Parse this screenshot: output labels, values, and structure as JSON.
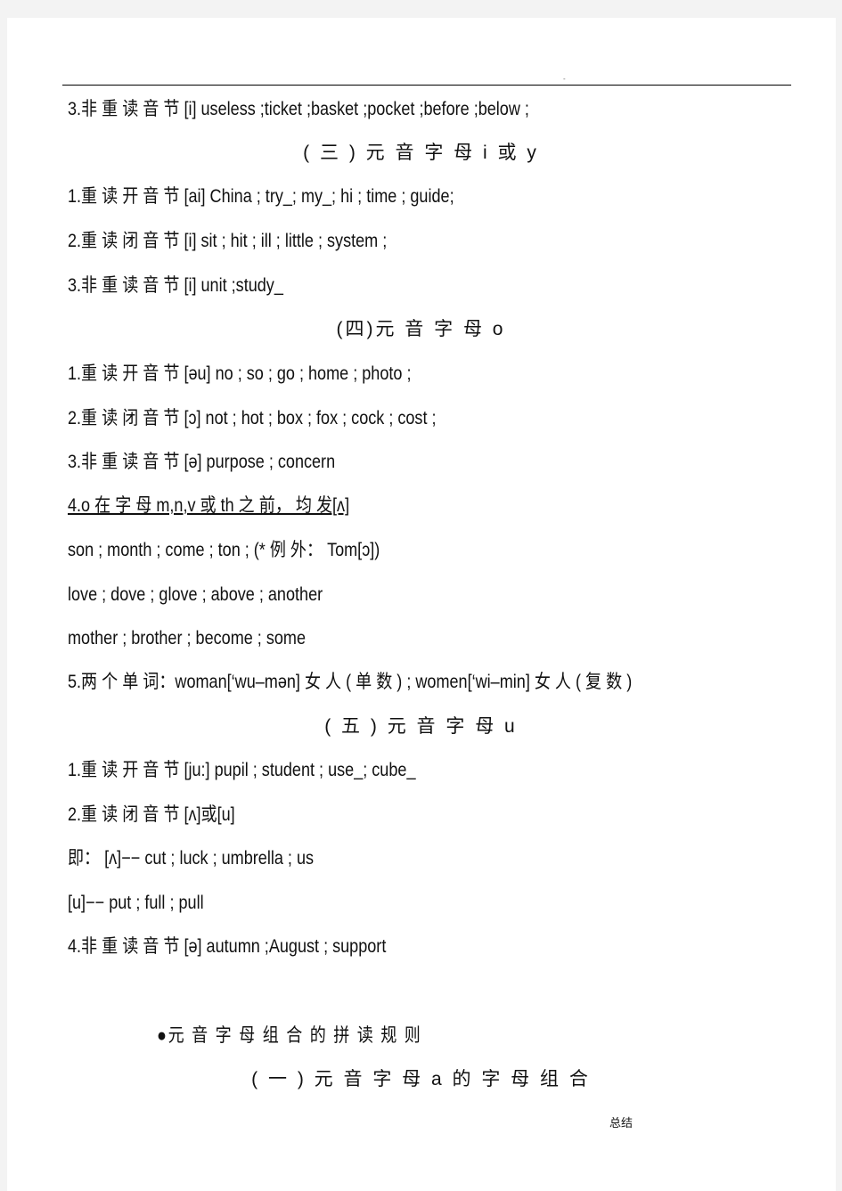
{
  "header": {
    "dot": "-"
  },
  "lines": [
    {
      "text": "3.非 重 读 音 节  [i]  useless  ;ticket  ;basket  ;pocket  ;before  ;below  ;",
      "center": false
    },
    {
      "text": "( 三 ) 元 音 字 母 i 或 y",
      "center": true
    },
    {
      "text": "1.重 读 开 音 节  [ai]  China ; try_; my_; hi ; time ; guide;",
      "center": false
    },
    {
      "text": "2.重 读 闭 音 节  [i]  sit ; hit ; ill ; little ; system ;",
      "center": false
    },
    {
      "text": "3.非 重 读 音 节  [i]  unit  ;study_",
      "center": false
    },
    {
      "text": "(四)元 音 字 母 o",
      "center": true
    },
    {
      "text": "1.重 读 开 音 节  [əu]  no ; so ; go ; home ; photo ;",
      "center": false
    },
    {
      "text": "2.重 读 闭 音 节  [ɔ]  not ; hot ; box ; fox ; cock ; cost ;",
      "center": false
    },
    {
      "text": "3.非 重 读 音 节  [ə]  purpose ; concern",
      "center": false
    },
    {
      "text": "4.o 在 字 母 m,n,v 或 th 之 前， 均 发[ʌ]",
      "center": false,
      "underline": true
    },
    {
      "text": "son ; month ; come ; ton ; (* 例 外： Tom[ɔ])",
      "center": false
    },
    {
      "text": "love ; dove ; glove ; above ; another",
      "center": false
    },
    {
      "text": "mother ; brother ; become ; some",
      "center": false
    },
    {
      "text": "5.两 个 单 词：woman[‘wu–mən] 女 人 ( 单 数 )  ; women[‘wi–min] 女 人 ( 复 数 )",
      "center": false
    },
    {
      "text": "( 五 ) 元 音 字 母 u",
      "center": true
    },
    {
      "text": "1.重 读 开 音 节  [ju:]  pupil ; student ; use_; cube_",
      "center": false
    },
    {
      "text": "2.重 读 闭 音 节  [ʌ]或[u]",
      "center": false
    },
    {
      "text": "即： [ʌ]−− cut ; luck ; umbrella ; us",
      "center": false
    },
    {
      "text": "[u]−− put ; full ; pull",
      "center": false
    },
    {
      "text": "4.非 重 读 音 节  [ə]  autumn  ;August ; support",
      "center": false
    },
    {
      "text": "●元 音 字 母 组 合 的 拼 读 规 则",
      "center": false,
      "indent": true
    },
    {
      "text": "( 一 ) 元 音 字 母 a 的 字 母 组 合",
      "center": true
    }
  ],
  "footer": {
    "label": "总结"
  }
}
